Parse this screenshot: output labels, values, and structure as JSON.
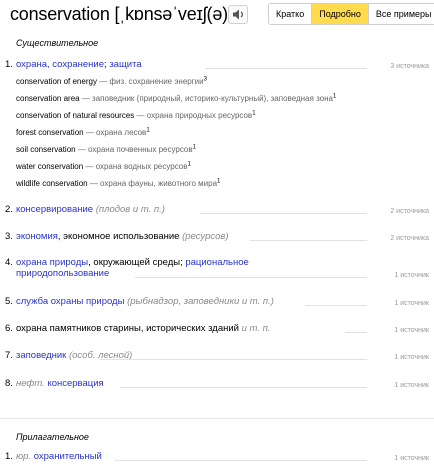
{
  "header": {
    "word": "conservation",
    "transcription": "[ˌkɒnsəˈveɪʃ(ə)n]",
    "tabs": [
      "Кратко",
      "Подробно",
      "Все примеры"
    ],
    "active_tab": "Подробно"
  },
  "noun_label": "Существительное",
  "meanings": [
    {
      "num": "1.",
      "parts": [
        [
          "l",
          "охрана, сохранение"
        ],
        [
          "t",
          "; "
        ],
        [
          "l",
          "защита"
        ]
      ],
      "source": "3 источника"
    },
    {
      "num": "2.",
      "parts": [
        [
          "l",
          "консервирование"
        ],
        [
          "t",
          " "
        ],
        [
          "i",
          "(плодов и т. п.)"
        ]
      ],
      "source": "2 источника"
    },
    {
      "num": "3.",
      "parts": [
        [
          "l",
          "экономия"
        ],
        [
          "t",
          ", экономное использование "
        ],
        [
          "i",
          "(ресурсов)"
        ]
      ],
      "source": "2 источника"
    },
    {
      "num": "4.",
      "parts": [
        [
          "l",
          "охрана природы"
        ],
        [
          "t",
          ", окружающей среды; "
        ],
        [
          "l",
          "рациональное"
        ]
      ],
      "line2": "природопользование",
      "source": "1 источник"
    },
    {
      "num": "5.",
      "parts": [
        [
          "l",
          "служба охраны природы"
        ],
        [
          "t",
          " "
        ],
        [
          "i",
          "(рыбнадзор, заповедники и т. п.)"
        ]
      ],
      "source": "1 источник"
    },
    {
      "num": "6.",
      "parts": [
        [
          "t",
          "охрана памятников старины, исторических зданий "
        ],
        [
          "i",
          "и т. п."
        ]
      ],
      "source": "1 источник"
    },
    {
      "num": "7.",
      "parts": [
        [
          "l",
          "заповедник"
        ],
        [
          "t",
          " "
        ],
        [
          "i",
          "(особ. лесной)"
        ]
      ],
      "source": "1 источник"
    },
    {
      "num": "8.",
      "parts": [
        [
          "i",
          "нефт."
        ],
        [
          "t",
          " "
        ],
        [
          "l",
          "консервация"
        ]
      ],
      "source": "1 источник"
    }
  ],
  "examples": [
    {
      "en": "conservation of energy",
      "dash": " — ",
      "ru": "физ. сохранение энергии",
      "sup": "3"
    },
    {
      "en": "conservation area",
      "dash": " — ",
      "ru": "заповедник (природный, историко-культурный), заповедная зона",
      "sup": "1"
    },
    {
      "en": "conservation of natural resources",
      "dash": " — ",
      "ru": "охрана природных ресурсов",
      "sup": "1"
    },
    {
      "en": "forest conservation",
      "dash": " — ",
      "ru": "охрана лесов",
      "sup": "1"
    },
    {
      "en": "soil conservation",
      "dash": " — ",
      "ru": "охрана почвенных ресурсов",
      "sup": "1"
    },
    {
      "en": "water conservation",
      "dash": " — ",
      "ru": "охрана водных ресурсов",
      "sup": "1"
    },
    {
      "en": "wildlife conservation",
      "dash": " — ",
      "ru": "охрана фауны, животного мира",
      "sup": "1"
    }
  ],
  "adj_label": "Прилагательное",
  "adj_meaning": {
    "num": "1.",
    "label": "юр.",
    "word": "охранительный",
    "source": "1 источник"
  }
}
